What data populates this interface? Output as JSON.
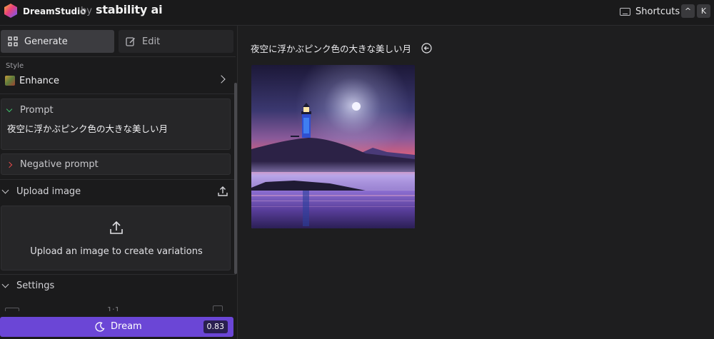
{
  "header": {
    "brand": "DreamStudio",
    "by": "by",
    "company": "stability ai",
    "shortcuts_label": "Shortcuts",
    "key_1": "^",
    "key_2": "K"
  },
  "tabs": [
    {
      "label": "Generate",
      "icon": "grid-icon",
      "active": true
    },
    {
      "label": "Edit",
      "icon": "edit-icon",
      "active": false
    }
  ],
  "style": {
    "label": "Style",
    "value": "Enhance"
  },
  "prompt": {
    "title": "Prompt",
    "value": "夜空に浮かぶピンク色の大きな美しい月"
  },
  "negative_prompt": {
    "title": "Negative prompt"
  },
  "upload": {
    "title": "Upload image",
    "area_text": "Upload an image to create variations"
  },
  "settings": {
    "title": "Settings",
    "aspect_ratio_peek": "1:1"
  },
  "dream_button": {
    "label": "Dream",
    "cost": "0.83"
  },
  "main": {
    "prompt_title": "夜空に浮かぶピンク色の大きな美しい月"
  },
  "colors": {
    "accent": "#6b46d6",
    "background": "#1e1e1f",
    "panel": "#1b1b1c"
  }
}
